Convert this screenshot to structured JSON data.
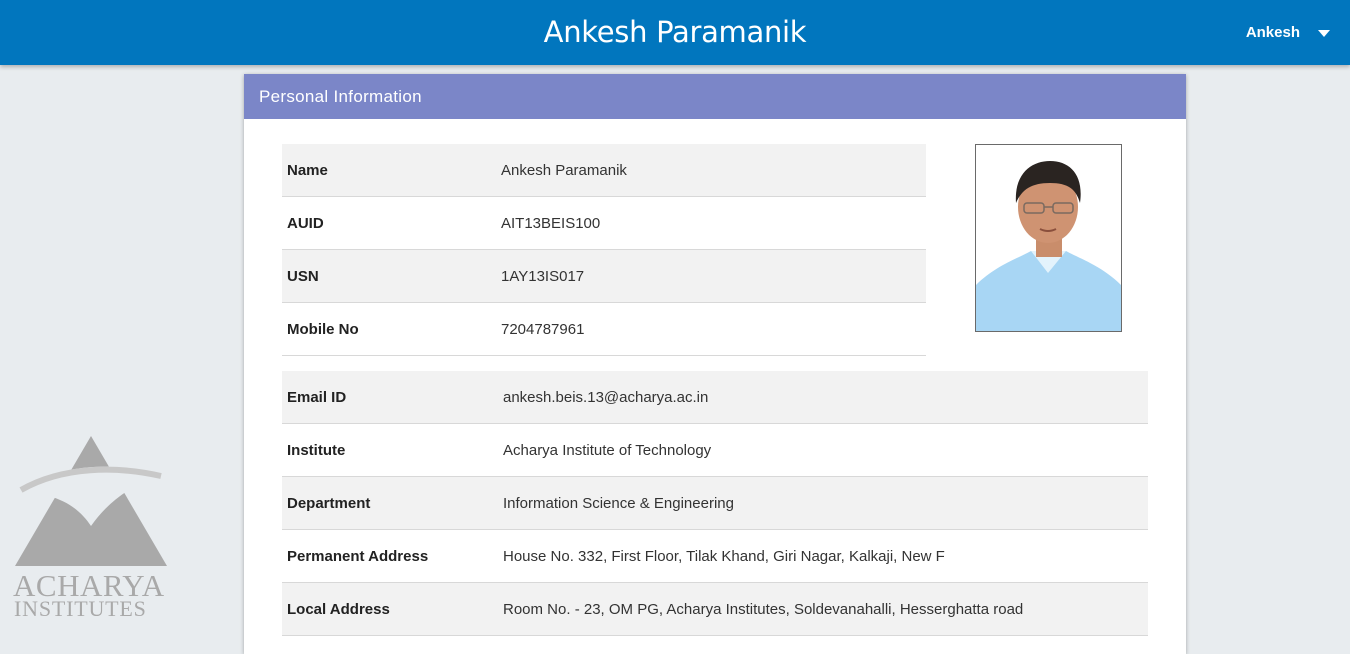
{
  "header": {
    "title": "Ankesh Paramanik",
    "user_name": "Ankesh"
  },
  "logo": {
    "line1": "ACHARYA",
    "line2": "INSTITUTES"
  },
  "card": {
    "title": "Personal Information",
    "top_rows": [
      {
        "label": "Name",
        "value": "Ankesh Paramanik"
      },
      {
        "label": "AUID",
        "value": "AIT13BEIS100"
      },
      {
        "label": "USN",
        "value": "1AY13IS017"
      },
      {
        "label": "Mobile No",
        "value": "7204787961"
      }
    ],
    "bottom_rows": [
      {
        "label": "Email ID",
        "value": "ankesh.beis.13@acharya.ac.in"
      },
      {
        "label": "Institute",
        "value": "Acharya Institute of Technology"
      },
      {
        "label": "Department",
        "value": "Information Science & Engineering"
      },
      {
        "label": "Permanent Address",
        "value": "House No. 332, First Floor, Tilak Khand, Giri Nagar, Kalkaji, New F"
      },
      {
        "label": "Local Address",
        "value": "Room No. - 23, OM PG, Acharya Institutes, Soldevanahalli, Hesserghatta road"
      }
    ]
  },
  "colors": {
    "topbar": "#0176be",
    "card_header": "#7b86c8",
    "row_shade": "#f2f2f2",
    "logo_gray": "#a9a9a9"
  },
  "icons": {
    "user_menu": "chevron-down-icon",
    "photo": "profile-photo"
  }
}
